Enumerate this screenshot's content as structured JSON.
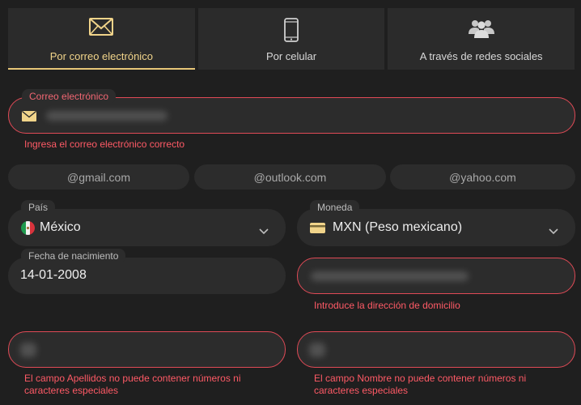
{
  "tabs": [
    {
      "label": "Por correo electrónico",
      "icon": "envelope-icon",
      "active": true
    },
    {
      "label": "Por celular",
      "icon": "smartphone-icon",
      "active": false
    },
    {
      "label": "A través de redes sociales",
      "icon": "users-group-icon",
      "active": false
    }
  ],
  "email": {
    "label": "Correo electrónico",
    "icon": "envelope-icon",
    "error": "Ingresa el correo electrónico correcto"
  },
  "domains": [
    "@gmail.com",
    "@outlook.com",
    "@yahoo.com"
  ],
  "country": {
    "label": "País",
    "value": "México",
    "icon": "mexico-flag-icon"
  },
  "currency": {
    "label": "Moneda",
    "value": "MXN (Peso mexicano)",
    "icon": "card-icon"
  },
  "birthdate": {
    "label": "Fecha de nacimiento",
    "value": "14-01-2008"
  },
  "address": {
    "error": "Introduce la dirección de domicilio"
  },
  "lastname": {
    "error": "El campo Apellidos no puede contener números ni caracteres especiales"
  },
  "firstname": {
    "error": "El campo Nombre no puede contener números ni caracteres especiales"
  },
  "colors": {
    "accent": "#e8c778",
    "error": "#e04a56",
    "background": "#1f1f1f",
    "field": "#2c2c2c"
  }
}
